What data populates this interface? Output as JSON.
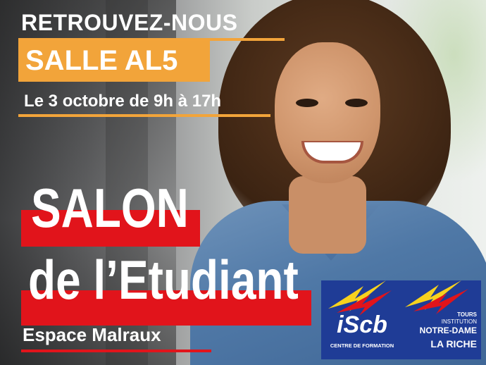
{
  "header": {
    "retrouvez": "RETROUVEZ-NOUS",
    "salle": "SALLE AL5",
    "date": "Le 3 octobre de 9h à 17h"
  },
  "event": {
    "line1": "SALON",
    "line2": "de l’Etudiant",
    "venue": "Espace Malraux"
  },
  "logos": {
    "iscb": {
      "name": "iScb",
      "subtitle": "CENTRE DE FORMATION"
    },
    "notre_dame": {
      "city": "TOURS",
      "institution": "INSTITUTION",
      "name": "NOTRE-DAME",
      "name2": "LA RICHE"
    }
  },
  "colors": {
    "orange": "#f2a43a",
    "red": "#e1141b",
    "navy": "#1f3c96",
    "yellow": "#f7d21e"
  }
}
